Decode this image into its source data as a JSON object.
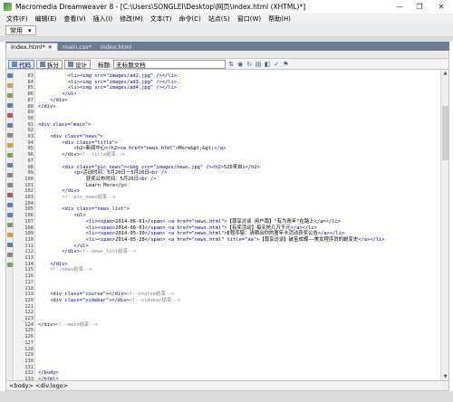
{
  "window": {
    "title": "Macromedia Dreamweaver 8 - [C:\\Users\\SONGLEI\\Desktop\\网页\\index.html (XHTML)*]",
    "minimize": "—",
    "maximize": "❐",
    "close": "✕"
  },
  "menu": [
    "文件(F)",
    "编辑(E)",
    "查看(V)",
    "插入(I)",
    "修改(M)",
    "文本(T)",
    "命令(C)",
    "站点(S)",
    "窗口(W)",
    "帮助(H)"
  ],
  "toolbar": {
    "insert_category": "常用",
    "dropdown_arrow": "▾"
  },
  "tabs": [
    {
      "label": "index.html*",
      "close": "✕"
    },
    {
      "label": "main.css*"
    },
    {
      "label": "index.html"
    }
  ],
  "filebar": {
    "path": ""
  },
  "view_buttons": {
    "code": "代码",
    "split": "拆分",
    "design": "设计"
  },
  "doc_title": {
    "label": "标题:",
    "value": "无标题文档"
  },
  "line_numbers": [
    "83",
    "84",
    "85",
    "86",
    "87",
    "88",
    "89",
    "90",
    "91",
    "92",
    "93",
    "94",
    "95",
    "96",
    "97",
    "98",
    "99",
    "100",
    "101",
    "102",
    "103",
    "104",
    "105",
    "106",
    "107",
    "108",
    "109",
    "110",
    "111",
    "112",
    "113",
    "114",
    "115",
    "116",
    "117",
    "118",
    "119",
    "120",
    "121",
    "122",
    "123",
    "124",
    "125",
    "126",
    "127",
    "128",
    "129",
    "130",
    "131",
    "132",
    "133"
  ],
  "code_lines": [
    {
      "indent": 10,
      "parts": [
        {
          "c": "tg",
          "t": "<li>"
        },
        {
          "c": "tg",
          "t": "<img src=\"images/ad2.jpg\" />"
        },
        {
          "c": "tg",
          "t": "</li>"
        }
      ]
    },
    {
      "indent": 10,
      "parts": [
        {
          "c": "tg",
          "t": "<li>"
        },
        {
          "c": "tg",
          "t": "<img src=\"images/ad3.jpg\" />"
        },
        {
          "c": "tg",
          "t": "</li>"
        }
      ]
    },
    {
      "indent": 10,
      "parts": [
        {
          "c": "tg",
          "t": "<li>"
        },
        {
          "c": "tg",
          "t": "<img src=\"images/ad4.jpg\" />"
        },
        {
          "c": "tg",
          "t": "</li>"
        }
      ]
    },
    {
      "indent": 8,
      "parts": [
        {
          "c": "tg",
          "t": "</ul>"
        }
      ]
    },
    {
      "indent": 4,
      "parts": [
        {
          "c": "tg",
          "t": "</div>"
        }
      ]
    },
    {
      "indent": 0,
      "parts": [
        {
          "c": "tg",
          "t": "</div>"
        }
      ]
    },
    {
      "indent": 0,
      "parts": []
    },
    {
      "indent": 0,
      "parts": []
    },
    {
      "indent": 0,
      "parts": [
        {
          "c": "tg",
          "t": "<div class=\"main\">"
        }
      ]
    },
    {
      "indent": 0,
      "parts": []
    },
    {
      "indent": 4,
      "parts": [
        {
          "c": "tg",
          "t": "<div class=\"news\">"
        }
      ]
    },
    {
      "indent": 8,
      "parts": [
        {
          "c": "tg",
          "t": "<div class=\"title\">"
        }
      ]
    },
    {
      "indent": 12,
      "parts": [
        {
          "c": "tg",
          "t": "<h2>"
        },
        {
          "c": "tx",
          "t": "新闻中心"
        },
        {
          "c": "tg",
          "t": "</h2><a href=\"news.html\">"
        },
        {
          "c": "tx",
          "t": "More&gt;&gt;"
        },
        {
          "c": "tg",
          "t": "</a>"
        }
      ]
    },
    {
      "indent": 8,
      "parts": [
        {
          "c": "tg",
          "t": "</div>"
        },
        {
          "c": "cm",
          "t": "<!--title结束-->"
        }
      ]
    },
    {
      "indent": 0,
      "parts": []
    },
    {
      "indent": 8,
      "parts": [
        {
          "c": "tg",
          "t": "<div class=\"pic_news\">"
        },
        {
          "c": "tg",
          "t": "<img src=\"images/news.jpg\" />"
        },
        {
          "c": "tg",
          "t": "<h2>"
        },
        {
          "c": "tx",
          "t": "520来自i"
        },
        {
          "c": "tg",
          "t": "</h2>"
        }
      ]
    },
    {
      "indent": 12,
      "parts": [
        {
          "c": "tg",
          "t": "<p>"
        },
        {
          "c": "tx",
          "t": "活动时间：5月20日－5月26日"
        },
        {
          "c": "tg",
          "t": "<br />"
        }
      ]
    },
    {
      "indent": 16,
      "parts": [
        {
          "c": "tx",
          "t": "获奖公布时间：5月26日"
        },
        {
          "c": "tg",
          "t": "<br />"
        }
      ]
    },
    {
      "indent": 16,
      "parts": [
        {
          "c": "tx",
          "t": "Learn More"
        },
        {
          "c": "tg",
          "t": "</p>"
        }
      ]
    },
    {
      "indent": 8,
      "parts": [
        {
          "c": "tg",
          "t": "</div>"
        }
      ]
    },
    {
      "indent": 8,
      "parts": [
        {
          "c": "cm",
          "t": "<!--pic_news结束-->"
        }
      ]
    },
    {
      "indent": 0,
      "parts": []
    },
    {
      "indent": 8,
      "parts": [
        {
          "c": "tg",
          "t": "<div class=\"news_list\">"
        }
      ]
    },
    {
      "indent": 12,
      "parts": [
        {
          "c": "tg",
          "t": "<ul>"
        }
      ]
    },
    {
      "indent": 16,
      "parts": [
        {
          "c": "tg",
          "t": "<li><span>"
        },
        {
          "c": "tx",
          "t": "2014-06-01"
        },
        {
          "c": "tg",
          "t": "</span> <a href=\"news.html\">"
        },
        {
          "c": "tx",
          "t": "【尊享访谈 用户篇】\"有为青年\"在路上"
        },
        {
          "c": "tg",
          "t": "</a></li>"
        }
      ]
    },
    {
      "indent": 16,
      "parts": [
        {
          "c": "tg",
          "t": "<li><span>"
        },
        {
          "c": "tx",
          "t": "2014-06-01"
        },
        {
          "c": "tg",
          "t": "</span> <a href=\"news.html\">"
        },
        {
          "c": "tx",
          "t": "【有奖活动】每天抢几万千元"
        },
        {
          "c": "tg",
          "t": "</a></li>"
        }
      ]
    },
    {
      "indent": 16,
      "parts": [
        {
          "c": "tg",
          "t": "<li><span>"
        },
        {
          "c": "tx",
          "t": "2014-05-30"
        },
        {
          "c": "tg",
          "t": "</span> <a href=\"news.html\">"
        },
        {
          "c": "tx",
          "t": "E程序猿：请晒出你的童年卡活动获奖公告"
        },
        {
          "c": "tg",
          "t": "</a></li>"
        }
      ]
    },
    {
      "indent": 16,
      "parts": [
        {
          "c": "tg",
          "t": "<li><span>"
        },
        {
          "c": "tx",
          "t": "2014-05-28"
        },
        {
          "c": "tg",
          "t": "</span> <a href=\"news.html\" title=\"aa\">"
        },
        {
          "c": "tx",
          "t": "【尊享访谈】破茧成蝶——美女程序员的蜕变史"
        },
        {
          "c": "tg",
          "t": "</a></li>"
        }
      ]
    },
    {
      "indent": 12,
      "parts": [
        {
          "c": "tg",
          "t": "</ul>"
        }
      ]
    },
    {
      "indent": 8,
      "parts": [
        {
          "c": "tg",
          "t": "</div>"
        },
        {
          "c": "cm",
          "t": "<!--news_list结束-->"
        }
      ]
    },
    {
      "indent": 0,
      "parts": []
    },
    {
      "indent": 4,
      "parts": [
        {
          "c": "tg",
          "t": "</div>"
        }
      ]
    },
    {
      "indent": 4,
      "parts": [
        {
          "c": "cm",
          "t": "<!--news结束-->"
        }
      ]
    },
    {
      "indent": 0,
      "parts": []
    },
    {
      "indent": 0,
      "parts": []
    },
    {
      "indent": 0,
      "parts": []
    },
    {
      "indent": 4,
      "parts": [
        {
          "c": "tg",
          "t": "<div class=\"course\">"
        },
        {
          "c": "tg",
          "t": "</div>"
        },
        {
          "c": "cm",
          "t": "<!--course结束-->"
        }
      ]
    },
    {
      "indent": 4,
      "parts": [
        {
          "c": "tg",
          "t": "<div class=\"sidebar\">"
        },
        {
          "c": "tg",
          "t": "</div>"
        },
        {
          "c": "cm",
          "t": "<!--sidebar结束-->"
        }
      ]
    },
    {
      "indent": 0,
      "parts": []
    },
    {
      "indent": 0,
      "parts": []
    },
    {
      "indent": 0,
      "parts": []
    },
    {
      "indent": 0,
      "parts": [
        {
          "c": "tg",
          "t": "</div>"
        },
        {
          "c": "cm",
          "t": "<!--main结束-->"
        }
      ]
    },
    {
      "indent": 0,
      "parts": []
    },
    {
      "indent": 0,
      "parts": []
    },
    {
      "indent": 0,
      "parts": []
    },
    {
      "indent": 0,
      "parts": []
    },
    {
      "indent": 0,
      "parts": []
    },
    {
      "indent": 0,
      "parts": []
    },
    {
      "indent": 0,
      "parts": []
    },
    {
      "indent": 0,
      "parts": [
        {
          "c": "tg",
          "t": "</body>"
        }
      ]
    },
    {
      "indent": 0,
      "parts": [
        {
          "c": "tg",
          "t": "</html>"
        }
      ]
    }
  ],
  "status": {
    "tag_selector": "<body> <div.logo>"
  },
  "left_toolbar_icons": [
    "file-icon",
    "open-icon",
    "collapse-icon",
    "expand-icon",
    "select-parent-icon",
    "balance-icon",
    "line-numbers-icon",
    "highlight-icon",
    "wrap-icon",
    "syntax-icon",
    "comment-icon",
    "uncomment-icon",
    "snippet-icon",
    "indent-icon",
    "outdent-icon",
    "format-icon",
    "validate-icon",
    "check-icon",
    "browse-icon",
    "tag-icon"
  ],
  "colors": {
    "tag": "#000099",
    "comment": "#808080",
    "tabbar": "#6d7d91"
  }
}
